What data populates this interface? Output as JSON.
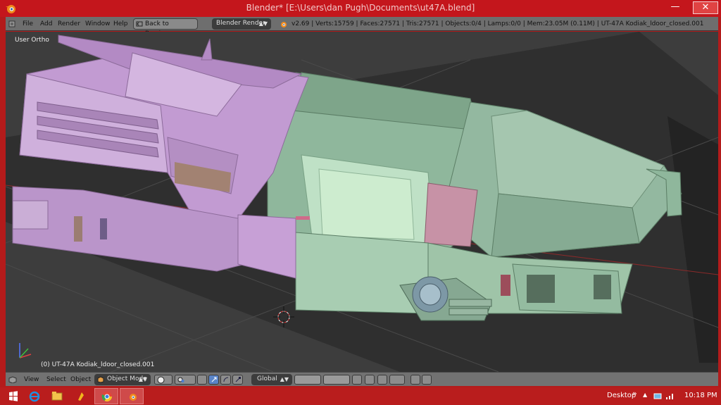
{
  "window": {
    "title": "Blender* [E:\\Users\\dan Pugh\\Documents\\ut47A.blend]",
    "minimize_glyph": "—",
    "maximize_glyph": "□",
    "close_glyph": "✕"
  },
  "info_header": {
    "menus": [
      "File",
      "Add",
      "Render",
      "Window",
      "Help"
    ],
    "back_button": "Back to Previous",
    "render_engine": "Blender Render",
    "stats": "v2.69 | Verts:15759 | Faces:27571 | Tris:27571 | Objects:0/4 | Lamps:0/0 | Mem:23.05M (0.11M) | UT-47A Kodiak_ldoor_closed.001"
  },
  "viewport": {
    "view_name": "User Ortho",
    "active_object": "(0) UT-47A Kodiak_ldoor_closed.001"
  },
  "view_header": {
    "menus": [
      "View",
      "Select",
      "Object"
    ],
    "mode": "Object Mode",
    "orientation": "Global"
  },
  "taskbar": {
    "desktop_label": "Desktop",
    "time": "10:18 PM",
    "chevron": "»"
  },
  "colors": {
    "titlebar": "#c4161c",
    "viewport_bg": "#3d3d3d",
    "selected_mesh": "#c9a3d8",
    "mesh": "#9fc4a8"
  },
  "icons": [
    "blender-logo-icon",
    "windows-start-icon",
    "ie-icon",
    "file-explorer-icon",
    "winamp-icon",
    "chrome-icon",
    "blender-taskbar-icon"
  ]
}
